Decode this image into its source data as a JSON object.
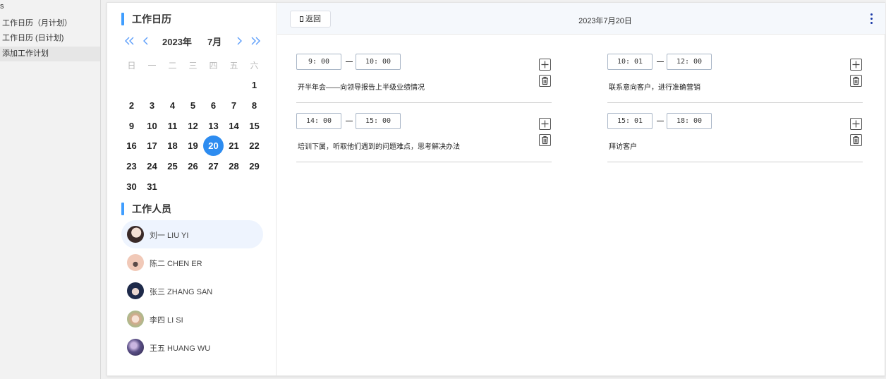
{
  "nav": {
    "header": "s",
    "items": [
      {
        "label": "工作日历（月计划）"
      },
      {
        "label": "工作日历 (日计划)"
      },
      {
        "label": "添加工作计划"
      }
    ]
  },
  "calendar": {
    "title": "工作日历",
    "year_label": "2023年",
    "month_label": "7月",
    "weekdays": [
      "日",
      "一",
      "二",
      "三",
      "四",
      "五",
      "六"
    ],
    "selected_day": 20,
    "days": [
      [
        null,
        null,
        null,
        null,
        null,
        null,
        1
      ],
      [
        2,
        3,
        4,
        5,
        6,
        7,
        8
      ],
      [
        9,
        10,
        11,
        12,
        13,
        14,
        15
      ],
      [
        16,
        17,
        18,
        19,
        20,
        21,
        22
      ],
      [
        23,
        24,
        25,
        26,
        27,
        28,
        29
      ],
      [
        30,
        31,
        null,
        null,
        null,
        null,
        null
      ]
    ]
  },
  "staff": {
    "title": "工作人员",
    "people": [
      {
        "name": "刘一 LIU YI",
        "active": true,
        "avatar_color": "#3a2a28"
      },
      {
        "name": "陈二 CHEN ER",
        "active": false,
        "avatar_color": "#f1c9b8"
      },
      {
        "name": "张三 ZHANG SAN",
        "active": false,
        "avatar_color": "#1e2a4a"
      },
      {
        "name": "李四 LI SI",
        "active": false,
        "avatar_color": "#d9a98f"
      },
      {
        "name": "王五 HUANG WU",
        "active": false,
        "avatar_color": "#5a4f86"
      }
    ]
  },
  "schedule": {
    "back_label": "返回",
    "date_title": "2023年7月20日",
    "entries": [
      {
        "start": "9: 00",
        "end": "10: 00",
        "desc": "开半年会——向领导报告上半级业绩情况"
      },
      {
        "start": "10: 01",
        "end": "12: 00",
        "desc": "联系意向客户，进行准确营销"
      },
      {
        "start": "14: 00",
        "end": "15: 00",
        "desc": "培训下属，听取他们遇到的问题难点，思考解决办法"
      },
      {
        "start": "15: 01",
        "end": "18: 00",
        "desc": "拜访客户"
      }
    ]
  },
  "colors": {
    "accent": "#409eff",
    "selected_day": "#2d8cf0",
    "nav_arrows": "#5b9dfa",
    "more_icon": "#1a3aa8"
  }
}
